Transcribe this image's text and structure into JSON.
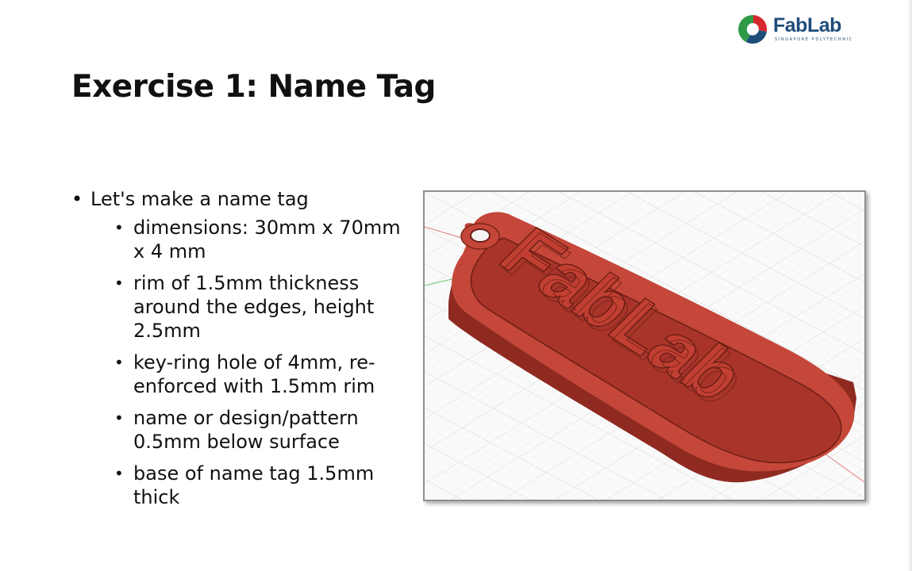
{
  "logo": {
    "name": "FabLab",
    "subtitle": "SINGAPORE POLYTECHNIC",
    "colors": {
      "red": "#d7282f",
      "green": "#2e9a47",
      "blue": "#1f4d7a"
    }
  },
  "title": "Exercise 1: Name Tag",
  "bullets": {
    "main": "Let's make a name tag",
    "items": [
      "dimensions: 30mm x 70mm x 4 mm",
      "rim of 1.5mm thickness around the edges, height 2.5mm",
      "key-ring hole of 4mm, re-enforced with 1.5mm rim",
      "name or design/pattern 0.5mm below surface",
      "base of name tag 1.5mm thick"
    ]
  },
  "render": {
    "engraved_text": "FabLab",
    "colors": {
      "body": "#b63a2b",
      "face": "#a8342a",
      "rim_top": "#c5473a",
      "side": "#8e2a20",
      "grid": "#d9d9d9"
    }
  }
}
